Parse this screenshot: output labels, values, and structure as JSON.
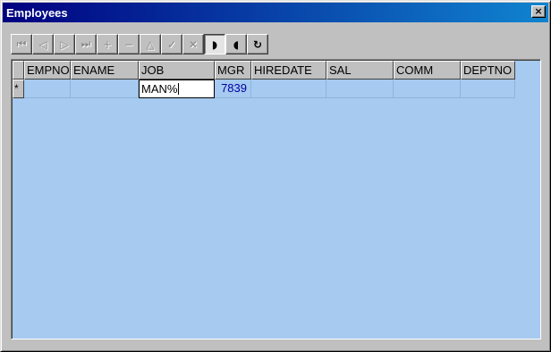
{
  "window": {
    "title": "Employees",
    "close_glyph": "×"
  },
  "toolbar": {
    "buttons": [
      {
        "name": "first-record",
        "glyph": "⏮",
        "state": "disabled"
      },
      {
        "name": "prior-record",
        "glyph": "◁",
        "state": "disabled"
      },
      {
        "name": "next-record",
        "glyph": "▷",
        "state": "disabled"
      },
      {
        "name": "last-record",
        "glyph": "⏭",
        "state": "disabled"
      },
      {
        "name": "insert-record",
        "glyph": "+",
        "state": "disabled"
      },
      {
        "name": "delete-record",
        "glyph": "−",
        "state": "disabled"
      },
      {
        "name": "edit-record",
        "glyph": "△",
        "state": "disabled"
      },
      {
        "name": "post-edit",
        "glyph": "✓",
        "state": "disabled"
      },
      {
        "name": "cancel-edit",
        "glyph": "✕",
        "state": "disabled"
      },
      {
        "name": "query-mode",
        "glyph": "◗",
        "state": "pressed"
      },
      {
        "name": "execute-query",
        "glyph": "◖",
        "state": "active"
      },
      {
        "name": "refresh",
        "glyph": "↻",
        "state": "active"
      }
    ]
  },
  "grid": {
    "columns": [
      "EMPNO",
      "ENAME",
      "JOB",
      "MGR",
      "HIREDATE",
      "SAL",
      "COMM",
      "DEPTNO"
    ],
    "row_indicator": "*",
    "rows": [
      {
        "EMPNO": "",
        "ENAME": "",
        "JOB": "MAN%",
        "MGR": "7839",
        "HIREDATE": "",
        "SAL": "",
        "COMM": "",
        "DEPTNO": ""
      }
    ],
    "editing_column": "JOB"
  },
  "colors": {
    "title_start": "#000080",
    "title_end": "#1084d0",
    "grid_background": "#a6caf0",
    "numeric_text": "#0000a0"
  }
}
